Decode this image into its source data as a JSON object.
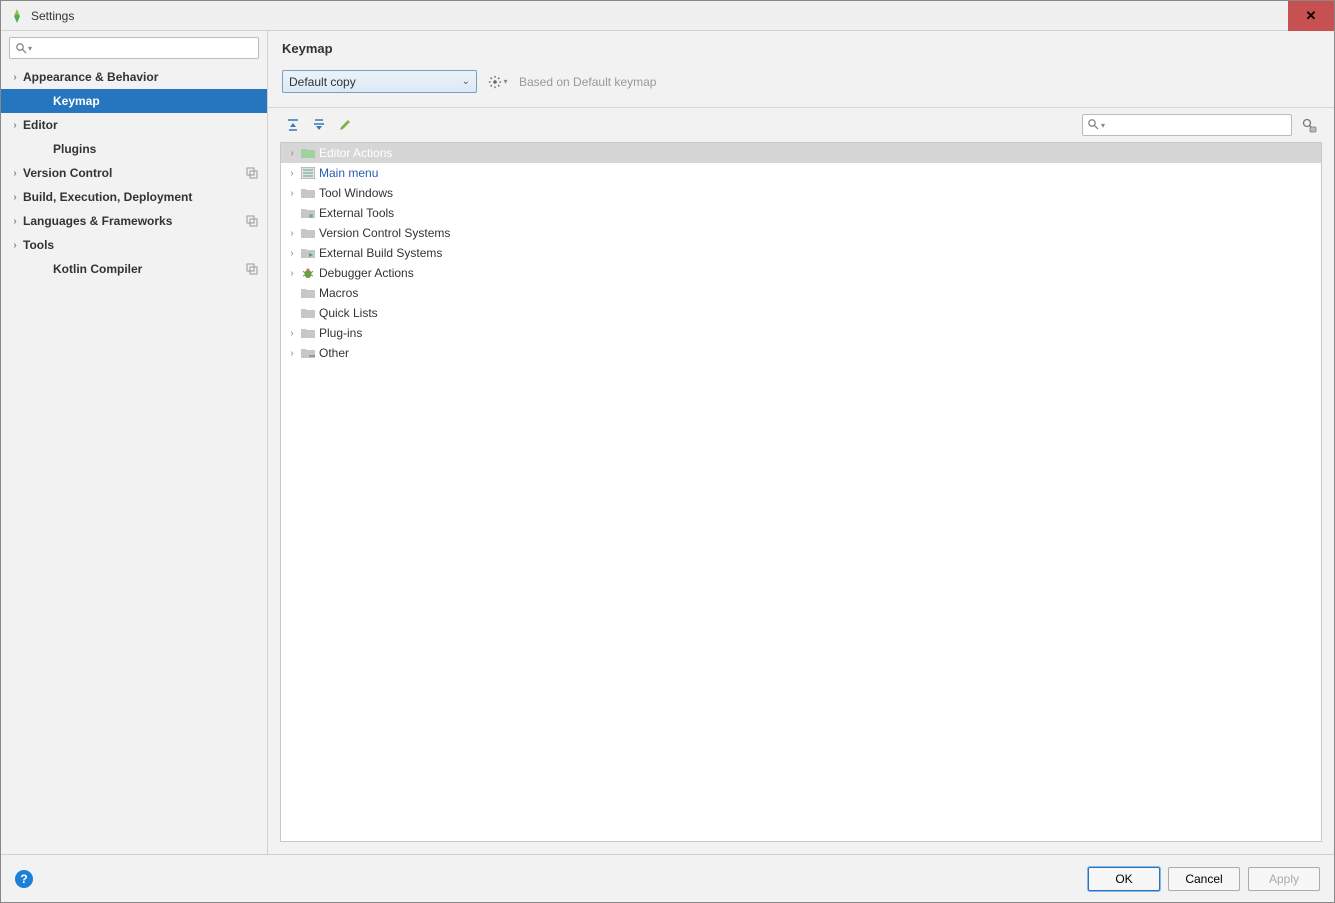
{
  "window": {
    "title": "Settings",
    "close_glyph": "✕"
  },
  "sidebar": {
    "search_placeholder": "",
    "items": [
      {
        "label": "Appearance & Behavior",
        "expandable": true,
        "level": 1
      },
      {
        "label": "Keymap",
        "expandable": false,
        "level": 2,
        "selected": true
      },
      {
        "label": "Editor",
        "expandable": true,
        "level": 1
      },
      {
        "label": "Plugins",
        "expandable": false,
        "level": 2
      },
      {
        "label": "Version Control",
        "expandable": true,
        "level": 1,
        "proj": true
      },
      {
        "label": "Build, Execution, Deployment",
        "expandable": true,
        "level": 1
      },
      {
        "label": "Languages & Frameworks",
        "expandable": true,
        "level": 1,
        "proj": true
      },
      {
        "label": "Tools",
        "expandable": true,
        "level": 1
      },
      {
        "label": "Kotlin Compiler",
        "expandable": false,
        "level": 2,
        "proj": true
      }
    ]
  },
  "content": {
    "heading": "Keymap",
    "keymap_selected": "Default copy",
    "based_on": "Based on Default keymap",
    "tree": [
      {
        "label": "Editor Actions",
        "expandable": true,
        "icon": "folder-green",
        "selected": true
      },
      {
        "label": "Main menu",
        "expandable": true,
        "icon": "menu",
        "link": true
      },
      {
        "label": "Tool Windows",
        "expandable": true,
        "icon": "folder"
      },
      {
        "label": "External Tools",
        "expandable": false,
        "icon": "tool"
      },
      {
        "label": "Version Control Systems",
        "expandable": true,
        "icon": "folder"
      },
      {
        "label": "External Build Systems",
        "expandable": true,
        "icon": "folder-arrow"
      },
      {
        "label": "Debugger Actions",
        "expandable": true,
        "icon": "bug"
      },
      {
        "label": "Macros",
        "expandable": false,
        "icon": "folder"
      },
      {
        "label": "Quick Lists",
        "expandable": false,
        "icon": "folder"
      },
      {
        "label": "Plug-ins",
        "expandable": true,
        "icon": "folder"
      },
      {
        "label": "Other",
        "expandable": true,
        "icon": "folder-dots"
      }
    ],
    "action_search_placeholder": ""
  },
  "footer": {
    "ok": "OK",
    "cancel": "Cancel",
    "apply": "Apply"
  }
}
